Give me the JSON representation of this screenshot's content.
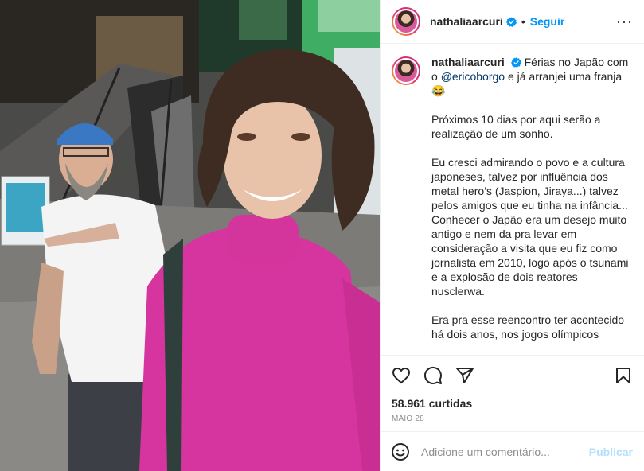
{
  "header": {
    "username": "nathaliaarcuri",
    "separator": "•",
    "follow_label": "Seguir",
    "more_label": "···"
  },
  "caption": {
    "username": "nathaliaarcuri",
    "line1_pre": "Férias no Japão com o ",
    "mention": "@ericoborgo",
    "line1_post": " e já arranjei uma franja 😂",
    "p2": "Próximos 10 dias por aqui serão a realização de um sonho.",
    "p3": "Eu cresci admirando o povo e a cultura japoneses, talvez por influência dos metal hero’s (Jaspion, Jiraya...) talvez pelos amigos que eu tinha na infância...\nConhecer o Japão era um desejo muito antigo e nem da pra levar em consideração a visita que eu fiz como jornalista em 2010, logo após o tsunami e a explosão de dois reatores nusclerwa.",
    "p4": "Era pra esse reencontro ter acontecido há dois anos, nos jogos olímpicos"
  },
  "stats": {
    "likes": "58.961 curtidas",
    "date": "MAIO 28"
  },
  "comment": {
    "placeholder": "Adicione um comentário...",
    "publish_label": "Publicar"
  },
  "icons": {
    "like": "heart-icon",
    "comment": "comment-icon",
    "share": "send-icon",
    "save": "bookmark-icon",
    "emoji": "emoji-icon",
    "verified": "verified-badge-icon"
  },
  "colors": {
    "accent": "#0095f6",
    "mention": "#00376b",
    "muted": "#8e8e8e",
    "publish_disabled": "#b2dffc",
    "verified": "#0095f6"
  }
}
